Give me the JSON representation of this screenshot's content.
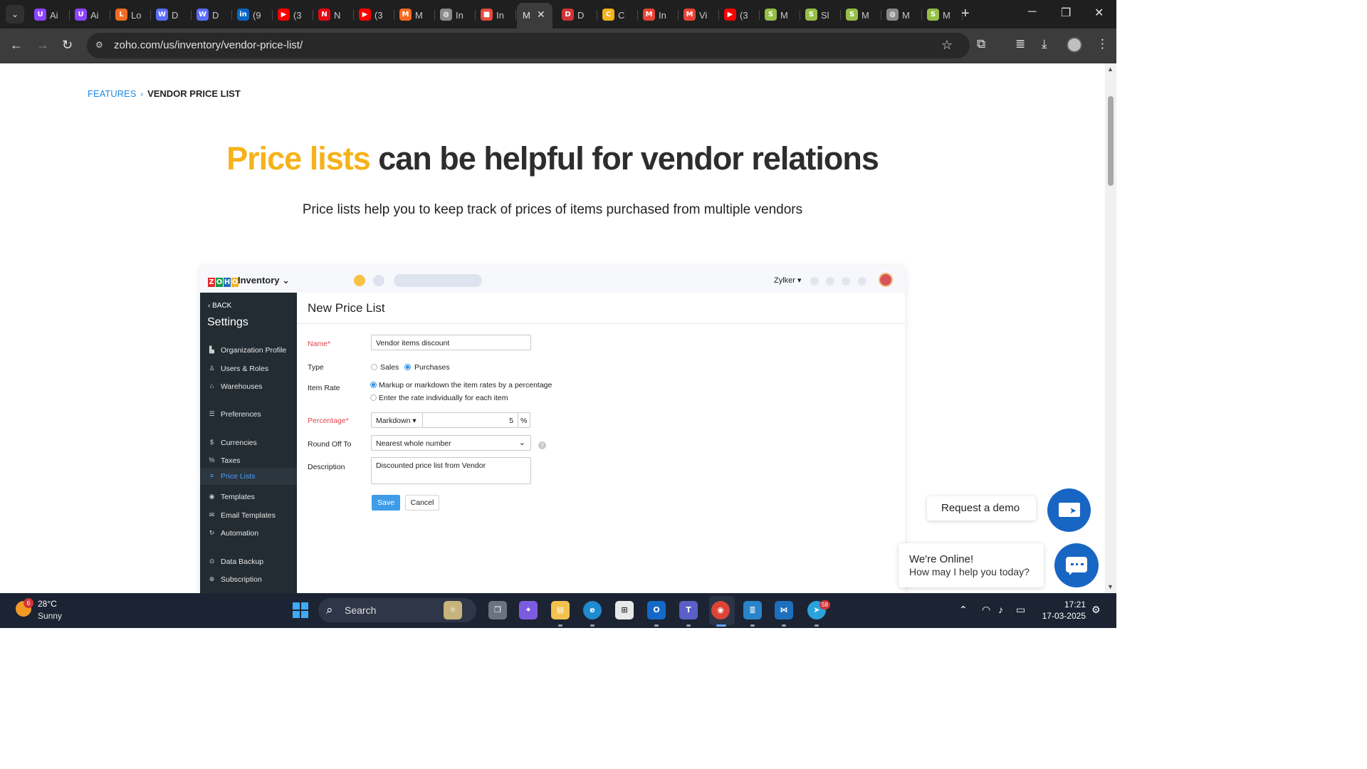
{
  "browser": {
    "tabs": [
      {
        "title": "Ai",
        "icon": "U",
        "color": "#8e44ff"
      },
      {
        "title": "Ai",
        "icon": "U",
        "color": "#8e44ff"
      },
      {
        "title": "Lo",
        "icon": "L",
        "color": "#f36b21"
      },
      {
        "title": "D",
        "icon": "W",
        "color": "#5a6dfa"
      },
      {
        "title": "D",
        "icon": "W",
        "color": "#5a6dfa"
      },
      {
        "title": "(9",
        "icon": "in",
        "color": "#0a66c2"
      },
      {
        "title": "(3",
        "icon": "▶",
        "color": "#ff0000"
      },
      {
        "title": "N",
        "icon": "N",
        "color": "#e50914"
      },
      {
        "title": "(3",
        "icon": "▶",
        "color": "#ff0000"
      },
      {
        "title": "M",
        "icon": "M",
        "color": "#f36b21"
      },
      {
        "title": "In",
        "icon": "◍",
        "color": "#8a8a8a"
      },
      {
        "title": "In",
        "icon": "■",
        "color": "#e84c3d"
      },
      {
        "title": "M",
        "icon": "",
        "color": "",
        "active": true
      },
      {
        "title": "D",
        "icon": "D",
        "color": "#d13438"
      },
      {
        "title": "C",
        "icon": "C",
        "color": "#f5b21a"
      },
      {
        "title": "In",
        "icon": "M",
        "color": "#ea4335"
      },
      {
        "title": "Vi",
        "icon": "M",
        "color": "#ea4335"
      },
      {
        "title": "(3",
        "icon": "▶",
        "color": "#ff0000"
      },
      {
        "title": "M",
        "icon": "S",
        "color": "#95bf47"
      },
      {
        "title": "Sl",
        "icon": "S",
        "color": "#95bf47"
      },
      {
        "title": "M",
        "icon": "S",
        "color": "#95bf47"
      },
      {
        "title": "M",
        "icon": "◍",
        "color": "#8a8a8a"
      },
      {
        "title": "M",
        "icon": "S",
        "color": "#95bf47"
      }
    ],
    "active_close": "✕",
    "new_tab": "+",
    "url": "zoho.com/us/inventory/vendor-price-list/"
  },
  "page": {
    "breadcrumb": {
      "parent": "FEATURES",
      "separator": "›",
      "current": "VENDOR PRICE LIST"
    },
    "hero": {
      "accent": "Price lists",
      "rest": " can be helpful for vendor relations"
    },
    "subtitle": "Price lists help you to keep track of prices of items purchased from multiple vendors"
  },
  "app": {
    "logo_letters": [
      {
        "ch": "Z",
        "color": "#e42527"
      },
      {
        "ch": "O",
        "color": "#089949"
      },
      {
        "ch": "H",
        "color": "#226db4"
      },
      {
        "ch": "O",
        "color": "#f9b21d"
      }
    ],
    "product": "Inventory ⌄",
    "org": "Zylker ▾",
    "sidebar": {
      "back": "‹ BACK",
      "title": "Settings",
      "items": [
        {
          "label": "Organization Profile",
          "icon": "building-icon",
          "glyph": "▙"
        },
        {
          "label": "Users & Roles",
          "icon": "users-icon",
          "glyph": "♙"
        },
        {
          "label": "Warehouses",
          "icon": "warehouse-icon",
          "glyph": "⌂"
        },
        {
          "label": "Preferences",
          "icon": "sliders-icon",
          "glyph": "☰"
        },
        {
          "label": "Currencies",
          "icon": "currency-icon",
          "glyph": "$"
        },
        {
          "label": "Taxes",
          "icon": "tax-icon",
          "glyph": "%"
        },
        {
          "label": "Price Lists",
          "icon": "list-icon",
          "glyph": "≡",
          "active": true
        },
        {
          "label": "Templates",
          "icon": "templates-icon",
          "glyph": "◉"
        },
        {
          "label": "Email Templates",
          "icon": "email-icon",
          "glyph": "✉"
        },
        {
          "label": "Automation",
          "icon": "automation-icon",
          "glyph": "↻"
        },
        {
          "label": "Data Backup",
          "icon": "backup-icon",
          "glyph": "⊙"
        },
        {
          "label": "Subscription",
          "icon": "subscription-icon",
          "glyph": "⊗"
        }
      ]
    },
    "form": {
      "title": "New Price List",
      "name_label": "Name*",
      "name_value": "Vendor items discount",
      "type_label": "Type",
      "type_options": [
        "Sales",
        "Purchases"
      ],
      "type_selected": "Purchases",
      "item_rate_label": "Item Rate",
      "item_rate_options": [
        "Markup or markdown the item rates by a percentage",
        "Enter the rate individually for each item"
      ],
      "percentage_label": "Percentage*",
      "percentage_mode": "Markdown ▾",
      "percentage_value": "5",
      "percentage_unit": "%",
      "round_label": "Round Off To",
      "round_value": "Nearest whole number",
      "description_label": "Description",
      "description_value": "Discounted price list from Vendor",
      "save": "Save",
      "cancel": "Cancel"
    }
  },
  "widgets": {
    "demo_text": "Request a demo",
    "chat_title": "We're Online!",
    "chat_subtitle": "How may I help you today?"
  },
  "taskbar": {
    "weather_badge": "6",
    "temperature": "28°C",
    "condition": "Sunny",
    "search_label": "Search",
    "telegram_badge": "58",
    "time": "17:21",
    "date": "17-03-2025"
  }
}
